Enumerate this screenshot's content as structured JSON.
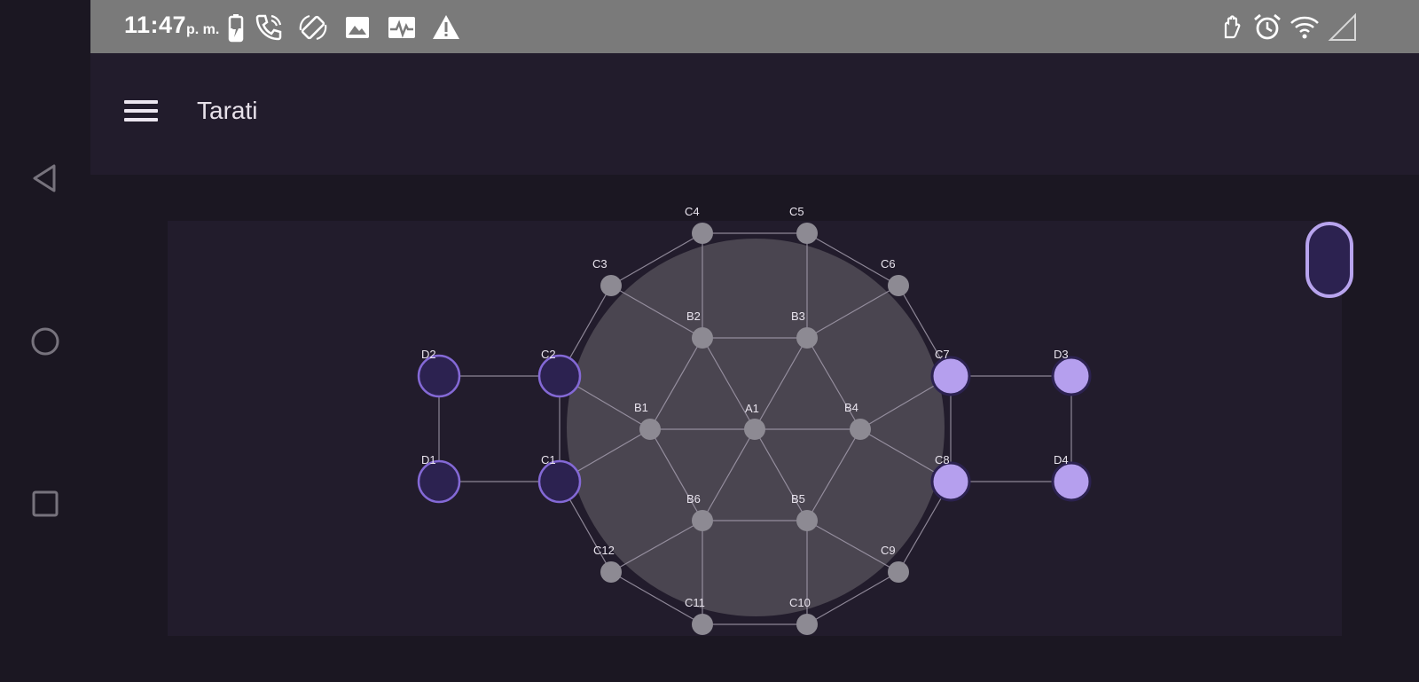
{
  "status_bar": {
    "time": "11:47",
    "ampm": "p. m.",
    "left_icons": [
      "battery-charging-icon",
      "phone-call-icon",
      "screen-rotate-icon",
      "image-icon",
      "activity-monitor-icon",
      "warning-icon"
    ],
    "right_icons": [
      "hand-gesture-icon",
      "alarm-clock-icon",
      "wifi-icon",
      "signal-icon"
    ]
  },
  "app_bar": {
    "title": "Tarati",
    "menu_icon": "hamburger-menu-icon"
  },
  "nav_bar": {
    "buttons": [
      "back-triangle-icon",
      "home-circle-icon",
      "recents-square-icon"
    ]
  },
  "colors": {
    "background": "#1b1722",
    "panel": "#221c2c",
    "status_bar": "#7a7a7a",
    "circle_fill": "#4a4550",
    "empty_node": "#8d8a93",
    "dark_piece_fill": "#2c2250",
    "dark_piece_stroke": "#8469d6",
    "light_piece_fill": "#b59fee",
    "edge": "#a19aaa",
    "toggle_border": "#b8a4ee"
  },
  "board": {
    "nodes": [
      {
        "id": "A1",
        "label": "A1",
        "piece": "empty"
      },
      {
        "id": "B1",
        "label": "B1",
        "piece": "empty"
      },
      {
        "id": "B2",
        "label": "B2",
        "piece": "empty"
      },
      {
        "id": "B3",
        "label": "B3",
        "piece": "empty"
      },
      {
        "id": "B4",
        "label": "B4",
        "piece": "empty"
      },
      {
        "id": "B5",
        "label": "B5",
        "piece": "empty"
      },
      {
        "id": "B6",
        "label": "B6",
        "piece": "empty"
      },
      {
        "id": "C1",
        "label": "C1",
        "piece": "dark"
      },
      {
        "id": "C2",
        "label": "C2",
        "piece": "dark"
      },
      {
        "id": "C3",
        "label": "C3",
        "piece": "empty"
      },
      {
        "id": "C4",
        "label": "C4",
        "piece": "empty"
      },
      {
        "id": "C5",
        "label": "C5",
        "piece": "empty"
      },
      {
        "id": "C6",
        "label": "C6",
        "piece": "empty"
      },
      {
        "id": "C7",
        "label": "C7",
        "piece": "light"
      },
      {
        "id": "C8",
        "label": "C8",
        "piece": "light"
      },
      {
        "id": "C9",
        "label": "C9",
        "piece": "empty"
      },
      {
        "id": "C10",
        "label": "C10",
        "piece": "empty"
      },
      {
        "id": "C11",
        "label": "C11",
        "piece": "empty"
      },
      {
        "id": "C12",
        "label": "C12",
        "piece": "empty"
      },
      {
        "id": "D1",
        "label": "D1",
        "piece": "dark"
      },
      {
        "id": "D2",
        "label": "D2",
        "piece": "dark"
      },
      {
        "id": "D3",
        "label": "D3",
        "piece": "light"
      },
      {
        "id": "D4",
        "label": "D4",
        "piece": "light"
      }
    ],
    "edges": [
      [
        "A1",
        "B1"
      ],
      [
        "A1",
        "B2"
      ],
      [
        "A1",
        "B3"
      ],
      [
        "A1",
        "B4"
      ],
      [
        "A1",
        "B5"
      ],
      [
        "A1",
        "B6"
      ],
      [
        "B1",
        "B2"
      ],
      [
        "B2",
        "B3"
      ],
      [
        "B3",
        "B4"
      ],
      [
        "B4",
        "B5"
      ],
      [
        "B5",
        "B6"
      ],
      [
        "B6",
        "B1"
      ],
      [
        "B1",
        "C1"
      ],
      [
        "B1",
        "C2"
      ],
      [
        "B2",
        "C3"
      ],
      [
        "B2",
        "C4"
      ],
      [
        "B3",
        "C5"
      ],
      [
        "B3",
        "C6"
      ],
      [
        "B4",
        "C7"
      ],
      [
        "B4",
        "C8"
      ],
      [
        "B5",
        "C9"
      ],
      [
        "B5",
        "C10"
      ],
      [
        "B6",
        "C11"
      ],
      [
        "B6",
        "C12"
      ],
      [
        "C1",
        "C2"
      ],
      [
        "C2",
        "C3"
      ],
      [
        "C3",
        "C4"
      ],
      [
        "C4",
        "C5"
      ],
      [
        "C5",
        "C6"
      ],
      [
        "C6",
        "C7"
      ],
      [
        "C7",
        "C8"
      ],
      [
        "C8",
        "C9"
      ],
      [
        "C9",
        "C10"
      ],
      [
        "C10",
        "C11"
      ],
      [
        "C11",
        "C12"
      ],
      [
        "C12",
        "C1"
      ],
      [
        "C1",
        "D1"
      ],
      [
        "C2",
        "D2"
      ],
      [
        "D1",
        "D2"
      ],
      [
        "C7",
        "D3"
      ],
      [
        "C8",
        "D4"
      ],
      [
        "D3",
        "D4"
      ]
    ]
  },
  "toggle_button": {
    "icon": "pill-toggle-icon"
  }
}
